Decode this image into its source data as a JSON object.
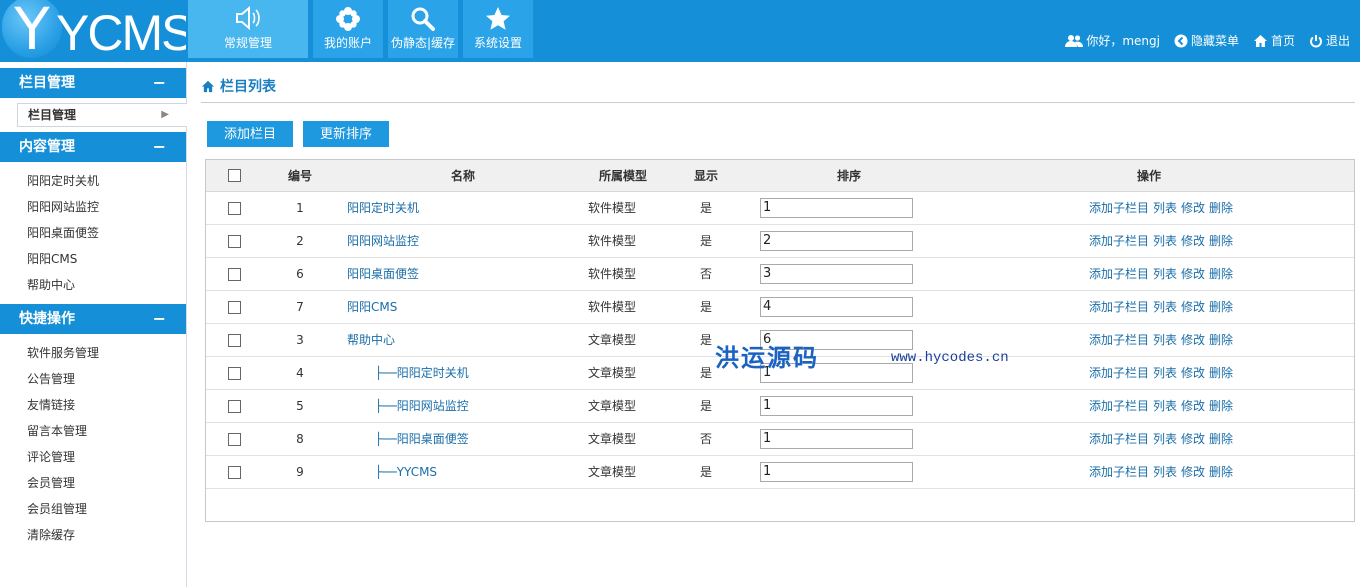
{
  "logo": {
    "y": "Y",
    "rest": "YCMS"
  },
  "nav": [
    {
      "label": "常规管理",
      "icon": "speaker-icon",
      "active": true
    },
    {
      "label": "我的账户",
      "icon": "flower-icon",
      "active": false
    },
    {
      "label": "伪静态|缓存",
      "icon": "search-icon",
      "active": false
    },
    {
      "label": "系统设置",
      "icon": "star-icon",
      "active": false
    }
  ],
  "topright": {
    "greeting": "你好，mengj",
    "hide_menu": "隐藏菜单",
    "home": "首页",
    "logout": "退出"
  },
  "sidebar": {
    "sections": [
      {
        "title": "栏目管理",
        "toggle": "−",
        "current": "栏目管理",
        "items": []
      },
      {
        "title": "内容管理",
        "toggle": "−",
        "items": [
          "阳阳定时关机",
          "阳阳网站监控",
          "阳阳桌面便签",
          "阳阳CMS",
          "帮助中心"
        ]
      },
      {
        "title": "快捷操作",
        "toggle": "−",
        "items": [
          "软件服务管理",
          "公告管理",
          "友情链接",
          "留言本管理",
          "评论管理",
          "会员管理",
          "会员组管理",
          "清除缓存"
        ]
      }
    ]
  },
  "main": {
    "breadcrumb": "栏目列表",
    "add_button": "添加栏目",
    "sort_button": "更新排序",
    "table": {
      "headers": {
        "id": "编号",
        "name": "名称",
        "model": "所属模型",
        "show": "显示",
        "sort": "排序",
        "ops": "操作"
      },
      "ops_labels": [
        "添加子栏目",
        "列表",
        "修改",
        "删除"
      ],
      "rows": [
        {
          "id": "1",
          "name": "阳阳定时关机",
          "prefix": "",
          "model": "软件模型",
          "show": "是",
          "sort": "1"
        },
        {
          "id": "2",
          "name": "阳阳网站监控",
          "prefix": "",
          "model": "软件模型",
          "show": "是",
          "sort": "2"
        },
        {
          "id": "6",
          "name": "阳阳桌面便签",
          "prefix": "",
          "model": "软件模型",
          "show": "否",
          "sort": "3"
        },
        {
          "id": "7",
          "name": "阳阳CMS",
          "prefix": "",
          "model": "软件模型",
          "show": "是",
          "sort": "4"
        },
        {
          "id": "3",
          "name": "帮助中心",
          "prefix": "",
          "model": "文章模型",
          "show": "是",
          "sort": "6"
        },
        {
          "id": "4",
          "name": "阳阳定时关机",
          "prefix": "├──",
          "model": "文章模型",
          "show": "是",
          "sort": "1"
        },
        {
          "id": "5",
          "name": "阳阳网站监控",
          "prefix": "├──",
          "model": "文章模型",
          "show": "是",
          "sort": "1"
        },
        {
          "id": "8",
          "name": "阳阳桌面便签",
          "prefix": "├──",
          "model": "文章模型",
          "show": "否",
          "sort": "1"
        },
        {
          "id": "9",
          "name": "YYCMS",
          "prefix": "├──",
          "model": "文章模型",
          "show": "是",
          "sort": "1"
        }
      ]
    }
  },
  "watermark": {
    "text": "洪运源码",
    "url": "www.hycodes.cn"
  }
}
